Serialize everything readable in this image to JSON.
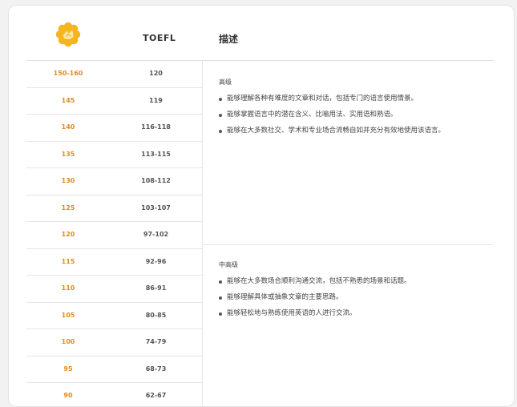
{
  "header": {
    "toefl_label": "TOEFL",
    "description_label": "描述"
  },
  "rows": [
    {
      "score": "150-160",
      "toefl": "120"
    },
    {
      "score": "145",
      "toefl": "119"
    },
    {
      "score": "140",
      "toefl": "116-118"
    },
    {
      "score": "135",
      "toefl": "113-115"
    },
    {
      "score": "130",
      "toefl": "108-112"
    },
    {
      "score": "125",
      "toefl": "103-107"
    },
    {
      "score": "120",
      "toefl": "97-102"
    },
    {
      "score": "115",
      "toefl": "92-96"
    },
    {
      "score": "110",
      "toefl": "86-91"
    },
    {
      "score": "105",
      "toefl": "80-85"
    },
    {
      "score": "100",
      "toefl": "74-79"
    },
    {
      "score": "95",
      "toefl": "68-73"
    },
    {
      "score": "90",
      "toefl": "62-67"
    }
  ],
  "levels": [
    {
      "title": "高级",
      "bullets": [
        "能够理解各种有难度的文章和对话，包括专门的语言使用情景。",
        "能够掌握语言中的潜在含义、比喻用法、实用语和熟语。",
        "能够在大多数社交、学术和专业场合流畅自如并充分有效地使用该语言。"
      ]
    },
    {
      "title": "中高级",
      "bullets": [
        "能够在大多数场合顺利沟通交流，包括不熟悉的场景和话题。",
        "能够理解具体或抽象文章的主要思路。",
        "能够轻松地与熟练使用英语的人进行交流。"
      ]
    }
  ],
  "colors": {
    "score": "#e38a1e",
    "logo": "#f5b51f"
  },
  "icons": {
    "logo": "flower-badge-icon"
  }
}
